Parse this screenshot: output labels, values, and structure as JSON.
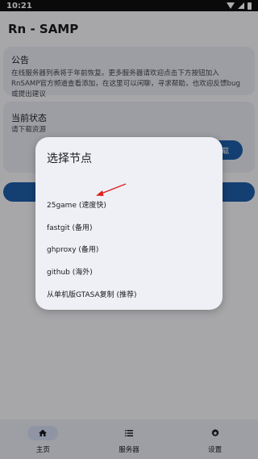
{
  "status_bar": {
    "time": "10:21"
  },
  "app": {
    "title": "Rn - SAMP"
  },
  "announcement": {
    "title": "公告",
    "body": "在线服务器列表将于年前恢复。更多服务器请欢迎点击下方按钮加入RnSAMP官方频道查看添加，在这里可以闲聊，寻求帮助，也欢迎反馈bug或提出建议"
  },
  "status_card": {
    "title": "当前状态",
    "body": "请下载资源",
    "download_label": "下载"
  },
  "dialog": {
    "title": "选择节点",
    "options": [
      {
        "label": "25game (速度快)"
      },
      {
        "label": "fastgit (备用)"
      },
      {
        "label": "ghproxy (备用)"
      },
      {
        "label": "github (海外)"
      },
      {
        "label": "从单机版GTASA复制 (推荐)"
      }
    ]
  },
  "bottom_nav": {
    "items": [
      {
        "label": "主页",
        "icon": "home-icon",
        "active": true
      },
      {
        "label": "服务器",
        "icon": "list-icon",
        "active": false
      },
      {
        "label": "设置",
        "icon": "gear-icon",
        "active": false
      }
    ]
  },
  "colors": {
    "accent": "#1d5ea8",
    "annotation_arrow": "#e02020"
  }
}
